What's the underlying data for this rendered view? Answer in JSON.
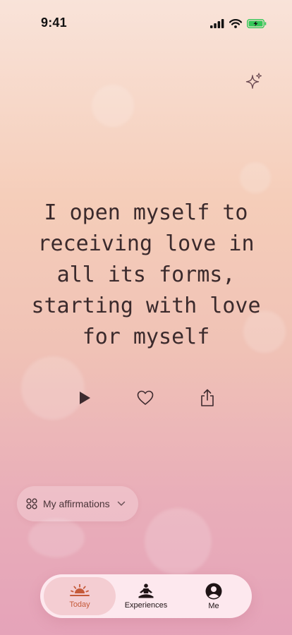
{
  "status_bar": {
    "time": "9:41"
  },
  "affirmation": {
    "text": "I open myself to receiving love in all its forms, starting with love for myself"
  },
  "actions": {
    "icons": [
      "play-icon",
      "heart-icon",
      "share-icon"
    ]
  },
  "collection_selector": {
    "label": "My affirmations",
    "icon": "grid-icon"
  },
  "tab_bar": {
    "tabs": [
      {
        "label": "Today",
        "icon": "sunrise-icon",
        "active": true
      },
      {
        "label": "Experiences",
        "icon": "meditation-icon",
        "active": false
      },
      {
        "label": "Me",
        "icon": "profile-icon",
        "active": false
      }
    ]
  },
  "colors": {
    "accent": "#c55a3a",
    "text": "#3b2a2c",
    "battery": "#35c759"
  }
}
